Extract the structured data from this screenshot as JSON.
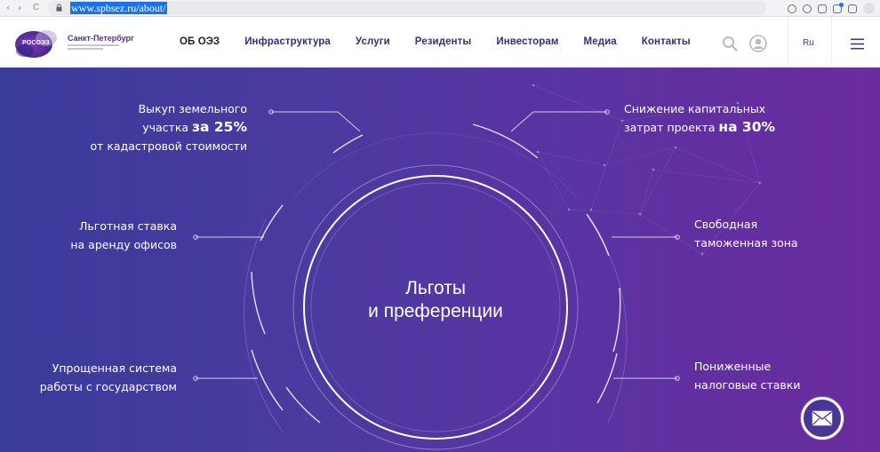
{
  "browser": {
    "url": "www.spbsez.ru/about/",
    "nav_back": "←",
    "nav_forward": "→",
    "nav_reload": "C"
  },
  "header": {
    "logo_abbr": "РОСОЭЗ",
    "logo_city": "Санкт-Петербург",
    "nav": [
      "ОБ ОЭЗ",
      "Инфраструктура",
      "Услуги",
      "Резиденты",
      "Инвесторам",
      "Медиа",
      "Контакты"
    ],
    "lang": "Ru"
  },
  "hero": {
    "title_line1": "Льготы",
    "title_line2": "и преференции",
    "benefits": {
      "land": {
        "line1": "Выкуп земельного",
        "line2_pre": "участка",
        "line2_bold": "за 25%",
        "line3": "от кадастровой стоимости"
      },
      "capex": {
        "line1": "Снижение капитальных",
        "line2_pre": "затрат проекта",
        "line2_bold": "на 30%"
      },
      "office": {
        "line1": "Льготная ставка",
        "line2": "на аренду офисов"
      },
      "customs": {
        "line1": "Свободная",
        "line2": "таможенная зона"
      },
      "gov": {
        "line1": "Упрощенная система",
        "line2": "работы с государством"
      },
      "tax": {
        "line1": "Пониженные",
        "line2": "налоговые ставки"
      }
    }
  },
  "colors": {
    "hero_start": "#3a3b9a",
    "hero_end": "#6b2b9e",
    "nav_text": "#2f3275",
    "brand": "#5b2c8f"
  },
  "icons": [
    "lock-icon",
    "search-icon",
    "user-icon",
    "menu-icon",
    "mail-icon"
  ]
}
